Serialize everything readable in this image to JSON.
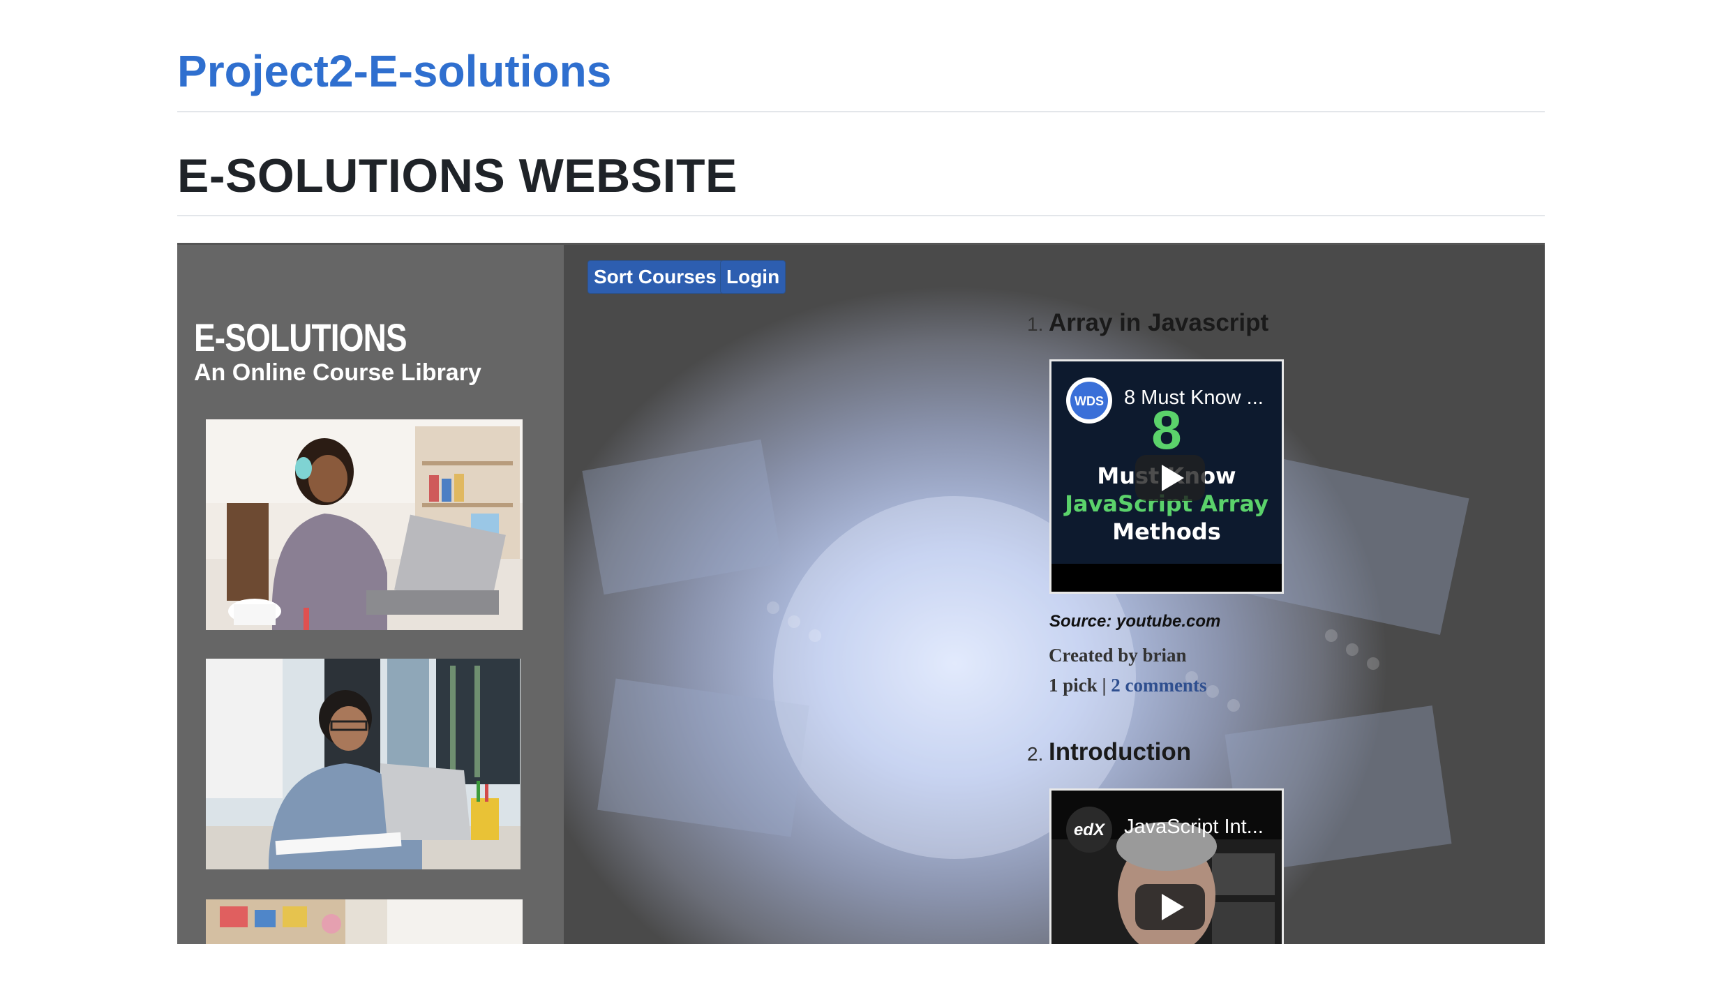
{
  "repo": {
    "title": "Project2-E-solutions"
  },
  "page": {
    "heading": "E-SOLUTIONS WEBSITE"
  },
  "site": {
    "brand": "E-SOLUTIONS",
    "tagline": "An Online Course Library",
    "nav": {
      "sort_label": "Sort Courses",
      "login_label": "Login"
    },
    "colors": {
      "sidebar": "#666666",
      "button": "#2d5eb0",
      "link": "#2f6fcf"
    }
  },
  "courses": [
    {
      "number": "1.",
      "title": "Array in Javascript",
      "video": {
        "channel_badge": "WDS",
        "title": "8 Must Know ...",
        "thumb_big": "8",
        "thumb_line1": "Must Know",
        "thumb_line2": "JavaScript Array",
        "thumb_line3": "Methods"
      },
      "source": "Source: youtube.com",
      "created_prefix": "Created by ",
      "creator": "brian",
      "picks": "1 pick",
      "separator": " | ",
      "comments": "2 comments"
    },
    {
      "number": "2.",
      "title": "Introduction",
      "video": {
        "channel_badge": "edX",
        "title": "JavaScript Int..."
      }
    }
  ]
}
